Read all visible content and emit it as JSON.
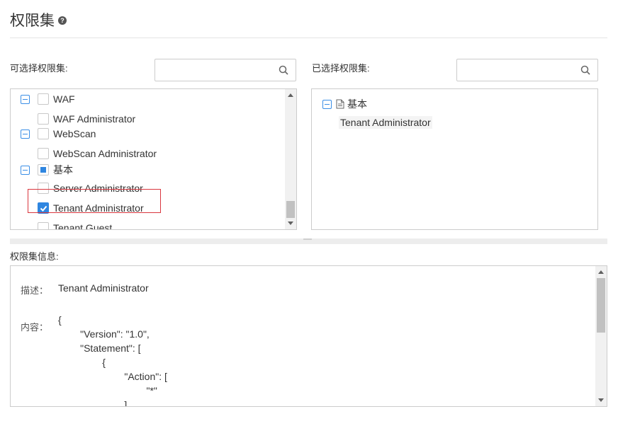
{
  "page": {
    "title": "权限集",
    "help_glyph": "?"
  },
  "available": {
    "label": "可选择权限集:",
    "search_placeholder": "",
    "tree": [
      {
        "label": "WAF",
        "level": 0,
        "expander": true,
        "state": "unchecked"
      },
      {
        "label": "WAF Administrator",
        "level": 1,
        "expander": false,
        "state": "unchecked"
      },
      {
        "label": "WebScan",
        "level": 0,
        "expander": true,
        "state": "unchecked"
      },
      {
        "label": "WebScan Administrator",
        "level": 1,
        "expander": false,
        "state": "unchecked"
      },
      {
        "label": "基本",
        "level": 0,
        "expander": true,
        "state": "partial"
      },
      {
        "label": "Server Administrator",
        "level": 1,
        "expander": false,
        "state": "unchecked"
      },
      {
        "label": "Tenant Administrator",
        "level": 1,
        "expander": false,
        "state": "checked"
      },
      {
        "label": "Tenant Guest",
        "level": 1,
        "expander": false,
        "state": "unchecked"
      }
    ]
  },
  "selected": {
    "label": "已选择权限集:",
    "search_placeholder": "",
    "group_label": "基本",
    "items": [
      "Tenant Administrator"
    ]
  },
  "info": {
    "label": "权限集信息:",
    "desc_key": "描述：",
    "desc_value": "Tenant Administrator",
    "content_key": "内容：",
    "content_lines": [
      "{",
      "        \"Version\": \"1.0\",",
      "        \"Statement\": [",
      "                {",
      "                        \"Action\": [",
      "                                \"*\"",
      "                        ]"
    ]
  },
  "colors": {
    "accent": "#2f86e0",
    "highlight_border": "#d9363e",
    "border": "#cccccc"
  }
}
